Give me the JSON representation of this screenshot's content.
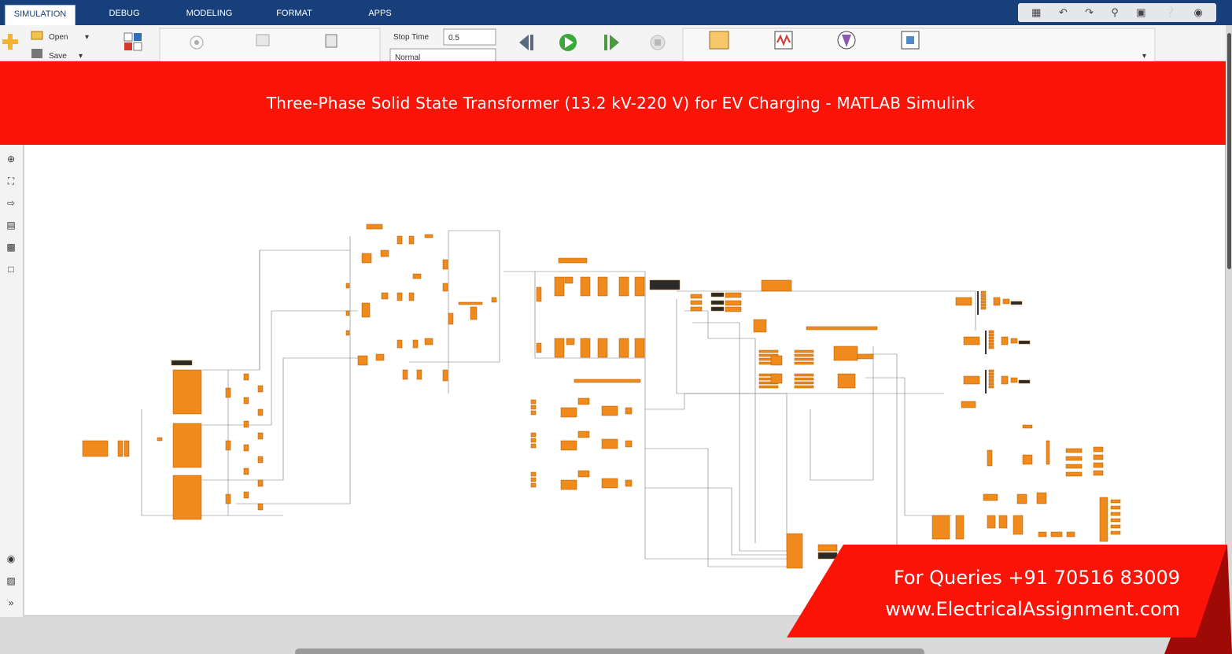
{
  "tabs": [
    {
      "label": "SIMULATION",
      "active": true
    },
    {
      "label": "DEBUG",
      "active": false
    },
    {
      "label": "MODELING",
      "active": false
    },
    {
      "label": "FORMAT",
      "active": false
    },
    {
      "label": "APPS",
      "active": false
    }
  ],
  "toolstrip": {
    "open_label": "Open",
    "save_label": "Save",
    "stop_time_label": "Stop Time",
    "stop_time_value": "0.5",
    "sim_mode_value": "Normal"
  },
  "banner": {
    "title": "Three-Phase Solid State Transformer (13.2 kV-220 V) for EV Charging - MATLAB Simulink"
  },
  "promo": {
    "line1": "For Queries +91 70516 83009",
    "line2": "www.ElectricalAssignment.com"
  },
  "colors": {
    "tab_bar": "#17407a",
    "banner": "#fb1307",
    "block_orange": "#f08a1c",
    "block_dark": "#2a2a2a"
  },
  "icons": [
    "new-model-icon",
    "open-folder-icon",
    "save-icon",
    "library-browser-icon",
    "step-back-icon",
    "run-icon",
    "step-forward-icon",
    "stop-icon",
    "data-inspector-icon",
    "logic-analyzer-icon",
    "bird-eye-icon",
    "sim-manager-icon",
    "zoom-icon",
    "fit-view-icon",
    "arrow-icon",
    "annotation-icon",
    "image-icon",
    "area-icon",
    "camera-icon",
    "property-icon",
    "expand-icon"
  ]
}
